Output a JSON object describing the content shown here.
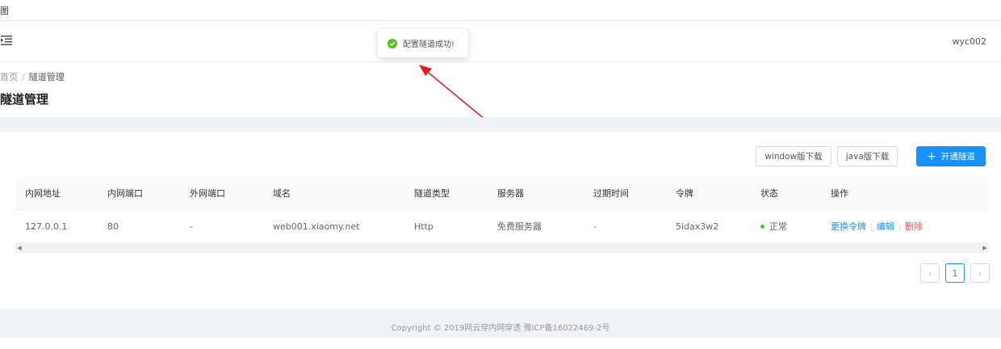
{
  "topbar": {
    "tiny_text": "图"
  },
  "header": {
    "username": "wyc002"
  },
  "toast": {
    "message": "配置隧道成功!"
  },
  "breadcrumb": {
    "home": "首页",
    "separator": "/",
    "current": "隧道管理"
  },
  "page": {
    "title": "隧道管理"
  },
  "toolbar": {
    "window_download": "window版下载",
    "java_download": "java版下载",
    "open_tunnel_icon": "+",
    "open_tunnel": "开通隧道"
  },
  "table": {
    "columns": [
      "内网地址",
      "内网端口",
      "外网端口",
      "域名",
      "隧道类型",
      "服务器",
      "过期时间",
      "令牌",
      "状态",
      "操作"
    ],
    "rows": [
      {
        "internal_address": "127.0.0.1",
        "internal_port": "80",
        "external_port": "-",
        "domain": "web001.xiaomy.net",
        "tunnel_type": "Http",
        "server": "免费服务器",
        "expire_time": "-",
        "token": "5idax3w2",
        "status": "正常",
        "actions": {
          "change_token": "更换令牌",
          "edit": "编辑",
          "delete": "删除"
        }
      }
    ]
  },
  "pagination": {
    "prev": "‹",
    "current_page": "1",
    "next": "›"
  },
  "footer": {
    "copyright": "Copyright © 2019网云穿内网穿透 豫ICP备16022469-2号"
  },
  "colors": {
    "primary": "#1890ff",
    "success": "#52c41a",
    "danger": "#ff4d4f",
    "annotation_arrow": "#e02020"
  }
}
